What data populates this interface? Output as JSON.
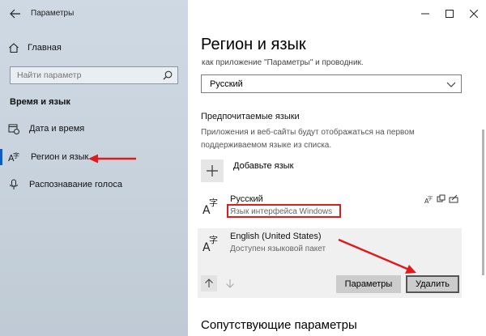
{
  "app": {
    "title": "Параметры"
  },
  "sidebar": {
    "home_label": "Главная",
    "search_placeholder": "Найти параметр",
    "section_title": "Время и язык",
    "items": [
      {
        "label": "Дата и время",
        "icon": "calendar-clock-icon"
      },
      {
        "label": "Регион и язык",
        "icon": "language-icon",
        "selected": true
      },
      {
        "label": "Распознавание голоса",
        "icon": "microphone-icon"
      }
    ]
  },
  "main": {
    "title": "Регион и язык",
    "subtext": "как приложение \"Параметры\" и проводник.",
    "display_language": "Русский",
    "preferred_title": "Предпочитаемые языки",
    "preferred_desc": "Приложения и веб-сайты будут отображаться на первом поддерживаемом языке из списка.",
    "add_language_label": "Добавьте язык",
    "languages": [
      {
        "name": "Русский",
        "sub": "Язык интерфейса Windows"
      },
      {
        "name": "English (United States)",
        "sub": "Доступен языковой пакет"
      }
    ],
    "params_button": "Параметры",
    "delete_button": "Удалить",
    "related_title": "Сопутствующие параметры"
  },
  "colors": {
    "annotation": "#e01b1b",
    "accent": "#0a5dc2"
  }
}
